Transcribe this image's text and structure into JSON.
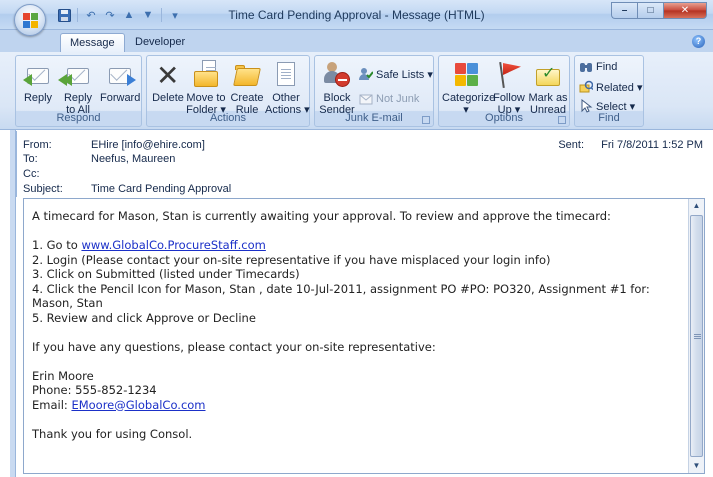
{
  "window": {
    "title": "Time Card Pending Approval - Message (HTML)",
    "controls": {
      "minimize": "–",
      "maximize": "□",
      "close": "✕"
    }
  },
  "quick_access": [
    "save-icon",
    "undo-icon",
    "redo-icon",
    "previous-icon",
    "next-icon",
    "customize-icon"
  ],
  "tabs": [
    {
      "label": "Message",
      "active": true
    },
    {
      "label": "Developer",
      "active": false
    }
  ],
  "ribbon": {
    "respond": {
      "label": "Respond",
      "reply": [
        "Reply",
        ""
      ],
      "reply_all": [
        "Reply",
        "to All"
      ],
      "forward": [
        "Forward",
        ""
      ]
    },
    "actions": {
      "label": "Actions",
      "delete": [
        "Delete",
        ""
      ],
      "move": [
        "Move to",
        "Folder ▾"
      ],
      "create_rule": [
        "Create",
        "Rule"
      ],
      "other": [
        "Other",
        "Actions ▾"
      ]
    },
    "junk": {
      "label": "Junk E-mail",
      "block": [
        "Block",
        "Sender"
      ],
      "safe_lists": "Safe Lists ▾",
      "not_junk": "Not Junk"
    },
    "options": {
      "label": "Options",
      "categorize": [
        "Categorize",
        "▾"
      ],
      "follow_up": [
        "Follow",
        "Up ▾"
      ],
      "mark_unread": [
        "Mark as",
        "Unread"
      ]
    },
    "find": {
      "label": "Find",
      "find": "Find",
      "related": "Related ▾",
      "select": "Select ▾"
    }
  },
  "header": {
    "from_label": "From:",
    "from_value": "EHire [info@ehire.com]",
    "to_label": "To:",
    "to_value": "Neefus, Maureen",
    "cc_label": "Cc:",
    "cc_value": "",
    "subject_label": "Subject:",
    "subject_value": "Time Card Pending Approval",
    "sent_label": "Sent:",
    "sent_value": "Fri 7/8/2011 1:52 PM"
  },
  "body": {
    "intro": "A timecard for Mason, Stan is currently awaiting your approval. To review and approve the timecard:",
    "step1_prefix": "1. Go to ",
    "step1_link": "www.GlobalCo.ProcureStaff.com",
    "step2": "2. Login (Please contact your on-site representative if you have misplaced your login info)",
    "step3": "3. Click on Submitted (listed under Timecards)",
    "step4": "4. Click the Pencil Icon for Mason, Stan , date 10-Jul-2011, assignment PO #PO: PO320, Assignment #1 for: Mason, Stan",
    "step5": "5. Review and click Approve or Decline",
    "questions": "If you have any questions, please contact your on-site representative:",
    "sig_name": "Erin Moore",
    "sig_phone": "Phone: 555-852-1234",
    "sig_email_prefix": "Email: ",
    "sig_email": "EMoore@GlobalCo.com",
    "closing": "Thank you for using Consol."
  },
  "colors": {
    "title_bar": "#c3d9f3",
    "ribbon": "#dae6f6",
    "link": "#1b30c8",
    "close_button": "#c8483a"
  }
}
